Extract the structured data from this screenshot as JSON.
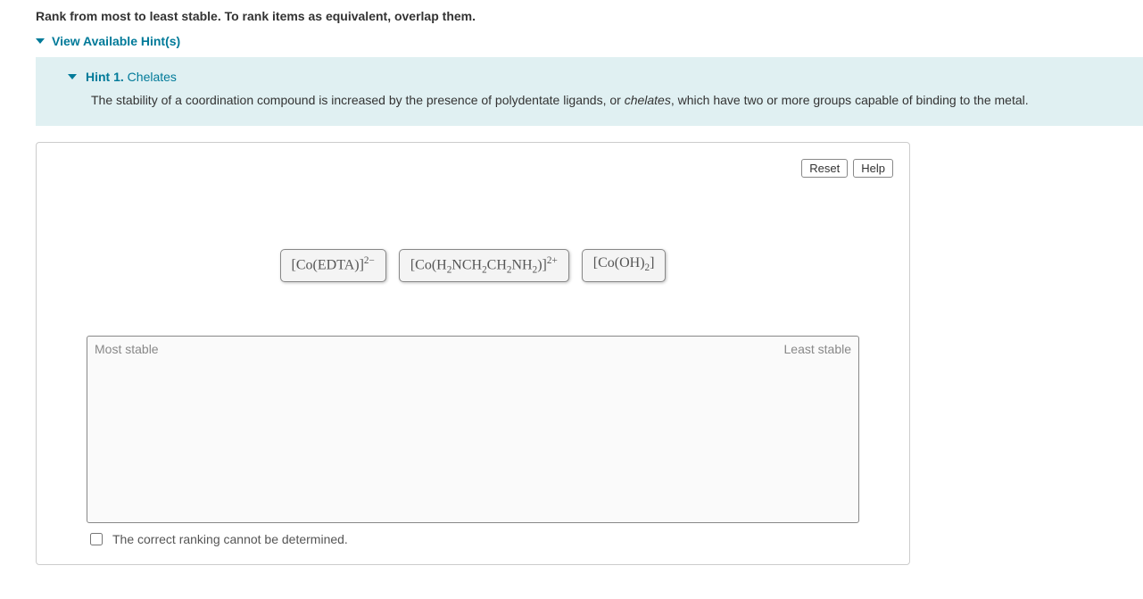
{
  "instruction": "Rank from most to least stable. To rank items as equivalent, overlap them.",
  "hints_toggle": "View Available Hint(s)",
  "hint": {
    "label": "Hint 1.",
    "title": "Chelates",
    "body_pre": "The stability of a coordination compound is increased by the presence of polydentate ligands, or ",
    "body_italic": "chelates",
    "body_post": ", which have two or more groups capable of binding to the metal."
  },
  "buttons": {
    "reset": "Reset",
    "help": "Help"
  },
  "items": [
    {
      "formula_html": "[Co(EDTA)]<sup>2−</sup>"
    },
    {
      "formula_html": "[Co(H<sub>2</sub>NCH<sub>2</sub>CH<sub>2</sub>NH<sub>2</sub>)]<sup>2+</sup>"
    },
    {
      "formula_html": "[Co(OH)<sub>2</sub>]"
    }
  ],
  "dropzone": {
    "left": "Most stable",
    "right": "Least stable"
  },
  "footer": {
    "cannot_determine": "The correct ranking cannot be determined."
  }
}
